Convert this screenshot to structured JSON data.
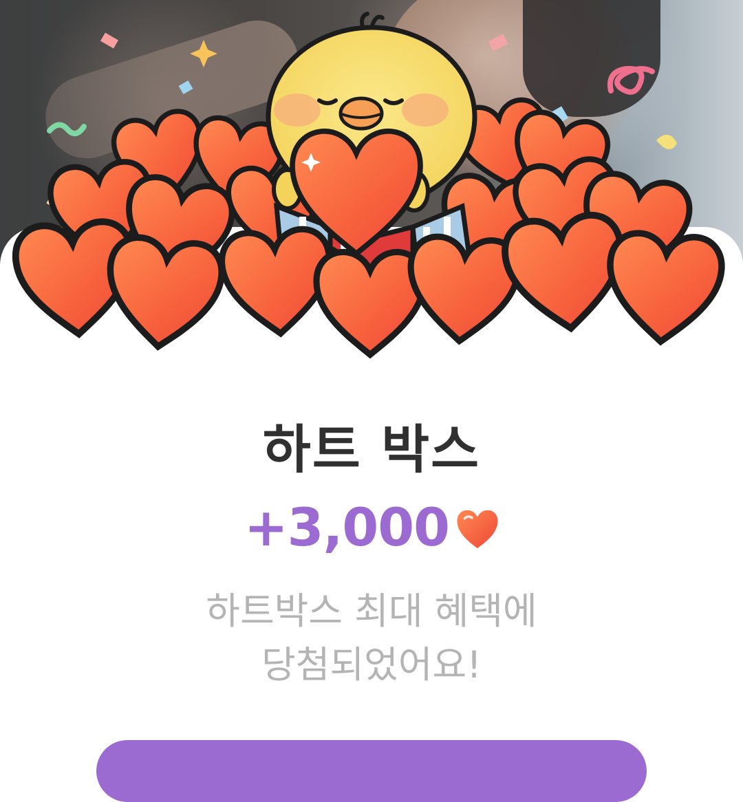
{
  "popup": {
    "title": "하트 박스",
    "reward_amount": "+3,000",
    "reward_icon": "heart-icon",
    "message_lines": [
      "하트박스 최대 혜택에",
      "당첨되었어요!"
    ]
  },
  "colors": {
    "accent": "#9b6bd2",
    "heart": "#f5573a",
    "title": "#303030",
    "message": "#b4b4b4"
  }
}
